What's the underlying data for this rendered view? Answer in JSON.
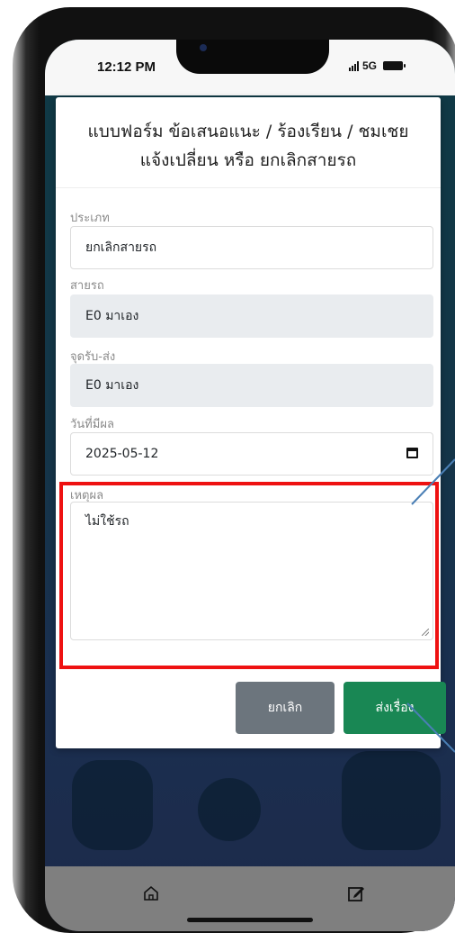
{
  "status_bar": {
    "time": "12:12 PM",
    "network": "5G"
  },
  "modal": {
    "title_line1": "แบบฟอร์ม ข้อเสนอแนะ / ร้องเรียน / ชมเชย",
    "title_line2": "แจ้งเปลี่ยน หรือ ยกเลิกสายรถ",
    "fields": {
      "type": {
        "label": "ประเภท",
        "value": "ยกเลิกสายรถ"
      },
      "route": {
        "label": "สายรถ",
        "value": "E0 มาเอง"
      },
      "pickup": {
        "label": "จุดรับ-ส่ง",
        "value": "E0 มาเอง"
      },
      "effective_date": {
        "label": "วันที่มีผล",
        "value": "2025-05-12"
      },
      "reason": {
        "label": "เหตุผล",
        "value": "ไม่ใช้รถ"
      }
    },
    "buttons": {
      "cancel": "ยกเลิก",
      "submit": "ส่งเรื่อง"
    }
  },
  "bottom_nav": {
    "items": [
      {
        "icon": "home-icon"
      },
      {
        "icon": "edit-icon"
      }
    ]
  },
  "colors": {
    "highlight_border": "#ee1111",
    "cancel_button": "#6c757d",
    "submit_button": "#198754",
    "bottom_bar": "#7f7f7f"
  }
}
